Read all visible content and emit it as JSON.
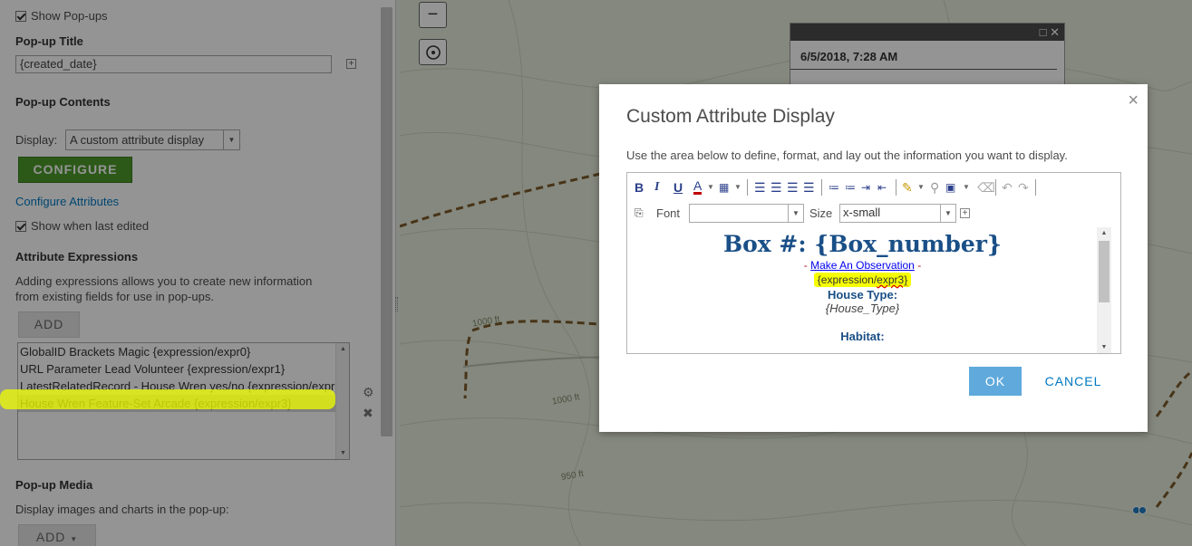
{
  "left_panel": {
    "show_popups": "Show Pop-ups",
    "popup_title_label": "Pop-up Title",
    "popup_title_value": "{created_date}",
    "popup_contents_label": "Pop-up Contents",
    "display_label": "Display:",
    "display_value": "A custom attribute display",
    "configure_button": "CONFIGURE",
    "configure_attributes_link": "Configure Attributes",
    "show_last_edited": "Show when last edited",
    "attribute_expressions_label": "Attribute Expressions",
    "attribute_expressions_desc_line1": "Adding expressions allows you to create new information",
    "attribute_expressions_desc_line2": "from existing fields for use in pop-ups.",
    "add_button": "ADD",
    "expressions": [
      "GlobalID Brackets Magic {expression/expr0}",
      "URL Parameter Lead Volunteer {expression/expr1}",
      "LatestRelatedRecord - House Wren yes/no {expression/expr2}",
      "House Wren Feature-Set Arcade {expression/expr3}"
    ],
    "popup_media_label": "Pop-up Media",
    "popup_media_desc": "Display images and charts in the pop-up:",
    "add_media_button": "ADD"
  },
  "map": {
    "zoom_out": "−",
    "contour_labels": [
      "1000 ft",
      "1000 ft",
      "950 ft"
    ],
    "popup": {
      "title": "6/5/2018, 7:28 AM",
      "maximize_icon": "□",
      "close_icon": "✕"
    }
  },
  "modal": {
    "title": "Custom Attribute Display",
    "description": "Use the area below to define, format, and lay out the information you want to display.",
    "close": "×",
    "toolbar": {
      "bold": "B",
      "italic": "I",
      "underline": "U",
      "font_color": "A",
      "font_label": "Font",
      "font_value": "",
      "size_label": "Size",
      "size_value": "x-small"
    },
    "content": {
      "heading": "Box #: {Box_number}",
      "observation_dash_left": "-",
      "observation_link": "Make An Observation",
      "observation_dash_right": "-",
      "expression_prefix": "{expression/",
      "expression_name": "expr3}",
      "house_type_label": "House Type:",
      "house_type_value": "{House_Type}",
      "habitat_label": "Habitat:"
    },
    "ok_button": "OK",
    "cancel_button": "CANCEL"
  }
}
